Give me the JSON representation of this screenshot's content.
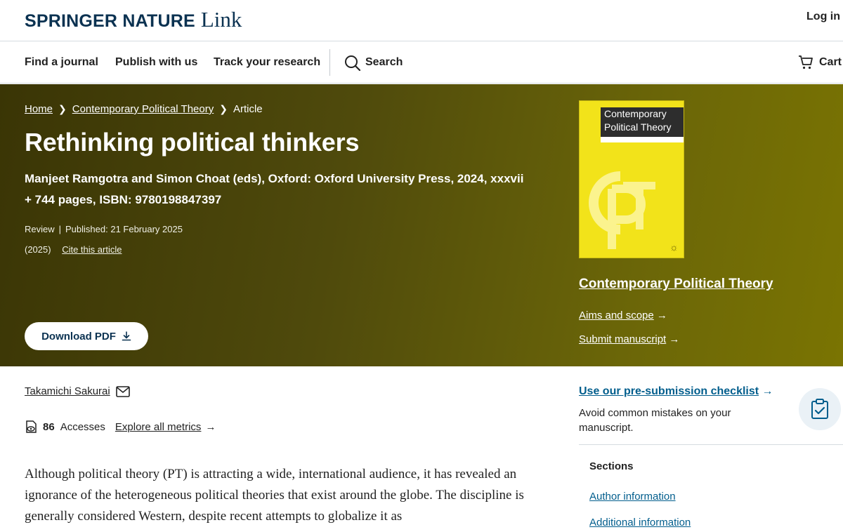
{
  "header": {
    "logo_main": "SPRINGER NATURE",
    "logo_sub": "Link",
    "login": "Log in"
  },
  "nav": {
    "items": [
      "Find a journal",
      "Publish with us",
      "Track your research"
    ],
    "search": "Search",
    "cart": "Cart"
  },
  "breadcrumb": {
    "home": "Home",
    "journal": "Contemporary Political Theory",
    "current": "Article",
    "separator": ">"
  },
  "article": {
    "title": "Rethinking political thinkers",
    "subtitle": "Manjeet Ramgotra and Simon Choat (eds), Oxford: Oxford University Press, 2024, xxxvii + 744 pages, ISBN: 9780198847397",
    "type": "Review",
    "divider": "|",
    "published": "Published: 21 February 2025",
    "year": "(2025)",
    "cite": "Cite this article",
    "download": "Download PDF"
  },
  "journal": {
    "cover_title_line1": "Contemporary",
    "cover_title_line2": "Political Theory",
    "name": "Contemporary Political Theory",
    "aims": "Aims and scope",
    "submit": "Submit manuscript",
    "arrow": "→"
  },
  "author": {
    "name": "Takamichi Sakurai"
  },
  "metrics": {
    "count": "86",
    "accesses": "Accesses",
    "explore": "Explore all metrics",
    "arrow": "→"
  },
  "body": {
    "paragraph": "Although political theory (PT) is attracting a wide, international audience, it has revealed an ignorance of the heterogeneous political theories that exist around the globe. The discipline is generally considered Western, despite recent attempts to globalize it as"
  },
  "sidebar": {
    "checklist": "Use our pre-submission checklist",
    "checklist_arrow": "→",
    "checklist_desc": "Avoid common mistakes on your manuscript.",
    "sections_heading": "Sections",
    "sections": [
      "Author information",
      "Additional information"
    ]
  },
  "colors": {
    "brand_navy": "#0b3251",
    "link_blue": "#025e8d",
    "hero_dark": "#3a3505",
    "hero_light": "#7a7402",
    "cover_yellow": "#f2e31a"
  }
}
